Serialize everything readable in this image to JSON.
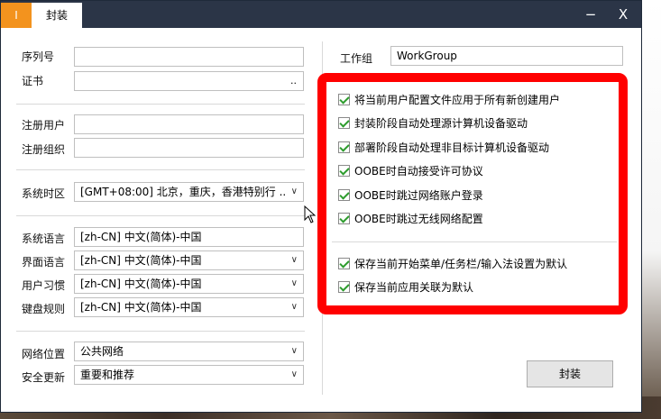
{
  "titlebar": {
    "orange_tab": "I",
    "active_tab": "封装",
    "minimize": "−",
    "close": "X"
  },
  "left": {
    "serial_label": "序列号",
    "serial_value": "",
    "cert_label": "证书",
    "cert_value": "",
    "cert_browse": "..",
    "reg_user_label": "注册用户",
    "reg_user_value": "",
    "reg_org_label": "注册组织",
    "reg_org_value": "",
    "timezone_label": "系统时区",
    "timezone_value": "[GMT+08:00] 北京，重庆，香港特别行 ..",
    "sys_lang_label": "系统语言",
    "sys_lang_value": "[zh-CN] 中文(简体)-中国",
    "ui_lang_label": "界面语言",
    "ui_lang_value": "[zh-CN] 中文(简体)-中国",
    "user_locale_label": "用户习惯",
    "user_locale_value": "[zh-CN] 中文(简体)-中国",
    "keyboard_label": "键盘规则",
    "keyboard_value": "[zh-CN] 中文(简体)-中国",
    "network_label": "网络位置",
    "network_value": "公共网络",
    "update_label": "安全更新",
    "update_value": "重要和推荐"
  },
  "right": {
    "workgroup_label": "工作组",
    "workgroup_value": "WorkGroup",
    "options": [
      {
        "label": "将当前用户配置文件应用于所有新创建用户",
        "checked": true
      },
      {
        "label": "封装阶段自动处理源计算机设备驱动",
        "checked": true
      },
      {
        "label": "部署阶段自动处理非目标计算机设备驱动",
        "checked": true
      },
      {
        "label": "OOBE时自动接受许可协议",
        "checked": true
      },
      {
        "label": "OOBE时跳过网络账户登录",
        "checked": true
      },
      {
        "label": "OOBE时跳过无线网络配置",
        "checked": true
      }
    ],
    "options2": [
      {
        "label": "保存当前开始菜单/任务栏/输入法设置为默认",
        "checked": true
      },
      {
        "label": "保存当前应用关联为默认",
        "checked": true
      }
    ],
    "seal_button": "封装"
  },
  "colors": {
    "titlebar": "#2b3547",
    "orange_tab": "#f3931e",
    "highlight": "#ff0000",
    "check": "#2e9c2e"
  }
}
